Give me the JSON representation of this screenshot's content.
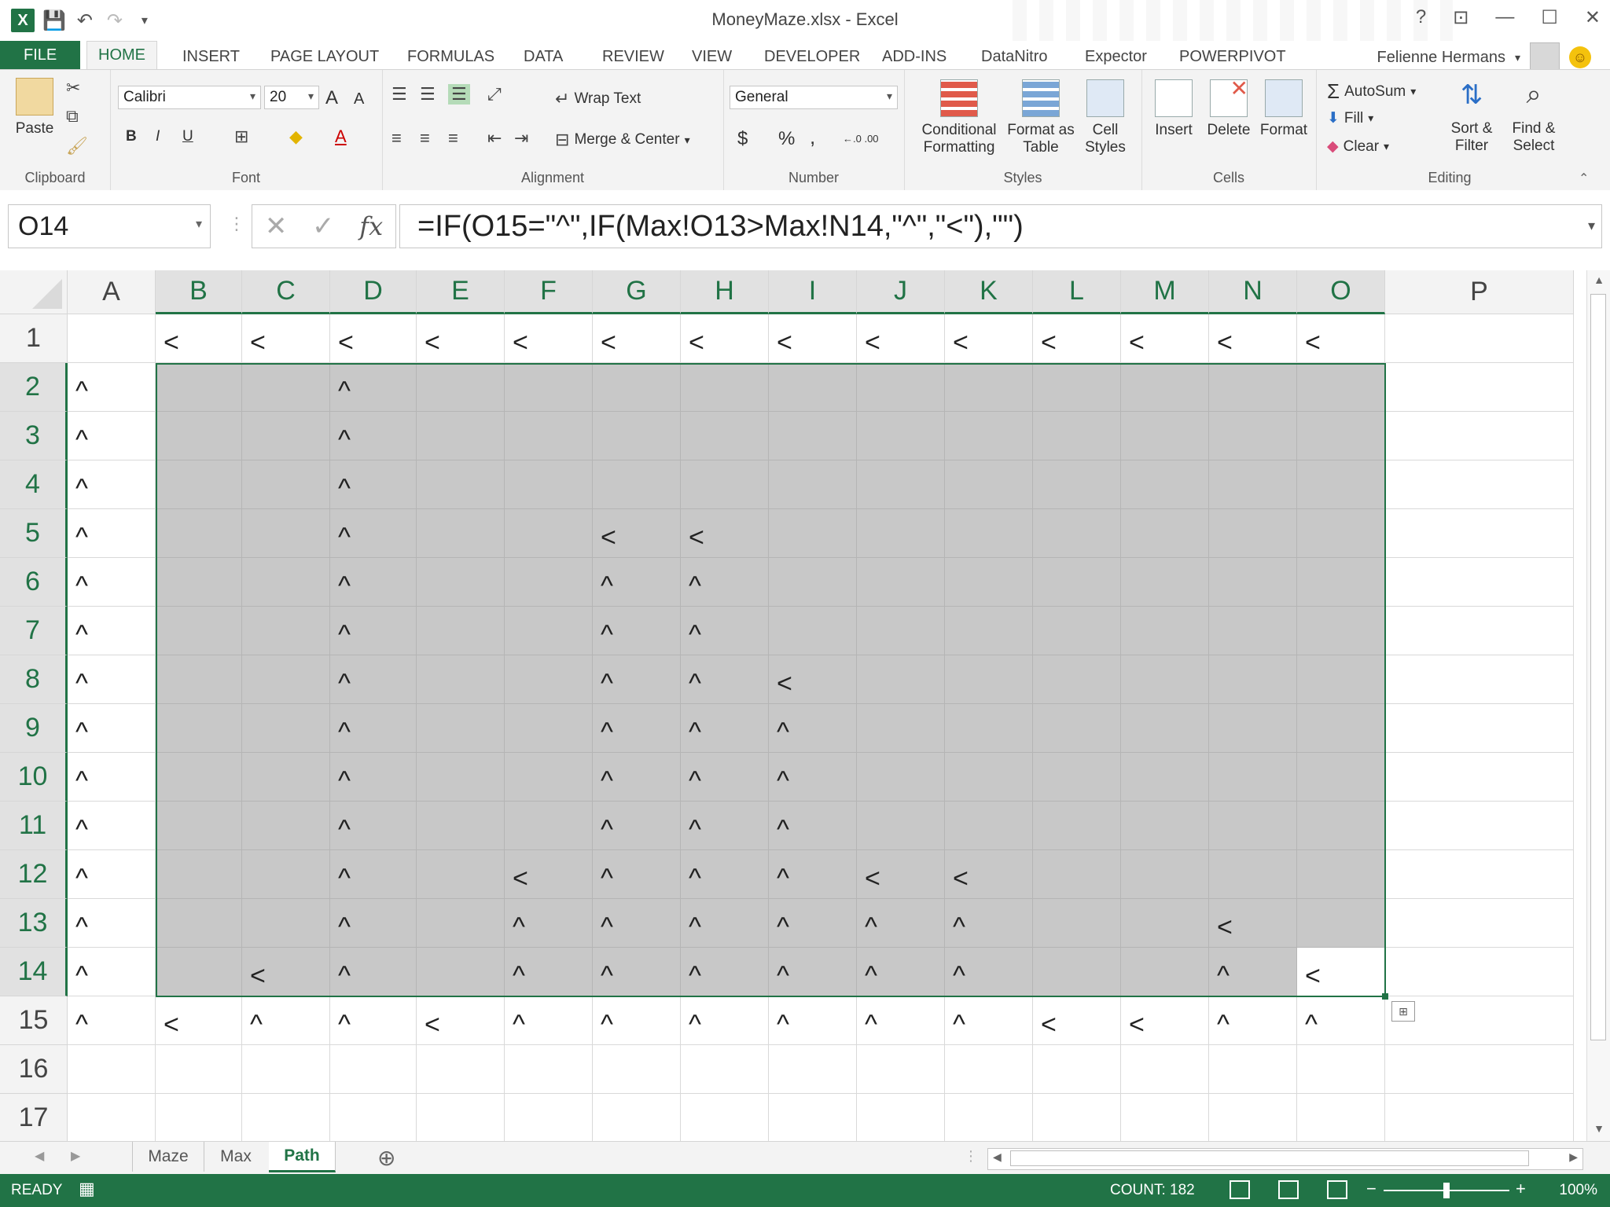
{
  "window": {
    "title": "MoneyMaze.xlsx - Excel",
    "help": "?",
    "restore_ribbon": "⊡",
    "minimize": "—",
    "maximize": "☐",
    "close": "✕"
  },
  "qat": {
    "save": "💾",
    "undo": "↶",
    "redo": "↷",
    "customize": "▾"
  },
  "tabs": [
    "FILE",
    "HOME",
    "INSERT",
    "PAGE LAYOUT",
    "FORMULAS",
    "DATA",
    "REVIEW",
    "VIEW",
    "DEVELOPER",
    "ADD-INS",
    "DataNitro",
    "Expector",
    "POWERPIVOT"
  ],
  "user": {
    "name": "Felienne Hermans"
  },
  "ribbon": {
    "clipboard": {
      "label": "Clipboard",
      "paste": "Paste"
    },
    "font": {
      "label": "Font",
      "name": "Calibri",
      "size": "20",
      "bold": "B",
      "italic": "I",
      "underline": "U",
      "grow": "A",
      "shrink": "A"
    },
    "alignment": {
      "label": "Alignment",
      "wrap": "Wrap Text",
      "merge": "Merge & Center"
    },
    "number": {
      "label": "Number",
      "format": "General",
      "currency": "$",
      "percent": "%",
      "comma": ",",
      "inc_dec": "←.0 .00",
      "dec_dec": ".00 →.0"
    },
    "styles": {
      "label": "Styles",
      "conditional1": "Conditional",
      "conditional2": "Formatting",
      "table1": "Format as",
      "table2": "Table",
      "cell1": "Cell",
      "cell2": "Styles"
    },
    "cells": {
      "label": "Cells",
      "insert": "Insert",
      "delete": "Delete",
      "format": "Format"
    },
    "editing": {
      "label": "Editing",
      "autosum": "AutoSum",
      "fill": "Fill",
      "clear": "Clear",
      "sort1": "Sort &",
      "sort2": "Filter",
      "find1": "Find &",
      "find2": "Select"
    }
  },
  "formula_bar": {
    "namebox": "O14",
    "cancel": "✕",
    "enter": "✓",
    "fx": "fx",
    "formula": "=IF(O15=\"^\",IF(Max!O13>Max!N14,\"^\",\"<\"),\"\")"
  },
  "columns": [
    "A",
    "B",
    "C",
    "D",
    "E",
    "F",
    "G",
    "H",
    "I",
    "J",
    "K",
    "L",
    "M",
    "N",
    "O",
    "P"
  ],
  "rows": [
    "1",
    "2",
    "3",
    "4",
    "5",
    "6",
    "7",
    "8",
    "9",
    "10",
    "11",
    "12",
    "13",
    "14",
    "15",
    "16",
    "17"
  ],
  "grid": [
    [
      "",
      "<",
      "<",
      "<",
      "<",
      "<",
      "<",
      "<",
      "<",
      "<",
      "<",
      "<",
      "<",
      "<",
      "<",
      ""
    ],
    [
      "^",
      "",
      "",
      "^",
      "",
      "",
      "",
      "",
      "",
      "",
      "",
      "",
      "",
      "",
      "",
      ""
    ],
    [
      "^",
      "",
      "",
      "^",
      "",
      "",
      "",
      "",
      "",
      "",
      "",
      "",
      "",
      "",
      "",
      ""
    ],
    [
      "^",
      "",
      "",
      "^",
      "",
      "",
      "",
      "",
      "",
      "",
      "",
      "",
      "",
      "",
      "",
      ""
    ],
    [
      "^",
      "",
      "",
      "^",
      "",
      "",
      "<",
      "<",
      "",
      "",
      "",
      "",
      "",
      "",
      "",
      ""
    ],
    [
      "^",
      "",
      "",
      "^",
      "",
      "",
      "^",
      "^",
      "",
      "",
      "",
      "",
      "",
      "",
      "",
      ""
    ],
    [
      "^",
      "",
      "",
      "^",
      "",
      "",
      "^",
      "^",
      "",
      "",
      "",
      "",
      "",
      "",
      "",
      ""
    ],
    [
      "^",
      "",
      "",
      "^",
      "",
      "",
      "^",
      "^",
      "<",
      "",
      "",
      "",
      "",
      "",
      "",
      ""
    ],
    [
      "^",
      "",
      "",
      "^",
      "",
      "",
      "^",
      "^",
      "^",
      "",
      "",
      "",
      "",
      "",
      "",
      ""
    ],
    [
      "^",
      "",
      "",
      "^",
      "",
      "",
      "^",
      "^",
      "^",
      "",
      "",
      "",
      "",
      "",
      "",
      ""
    ],
    [
      "^",
      "",
      "",
      "^",
      "",
      "",
      "^",
      "^",
      "^",
      "",
      "",
      "",
      "",
      "",
      "",
      ""
    ],
    [
      "^",
      "",
      "",
      "^",
      "",
      "<",
      "^",
      "^",
      "^",
      "<",
      "<",
      "",
      "",
      "",
      "",
      ""
    ],
    [
      "^",
      "",
      "",
      "^",
      "",
      "^",
      "^",
      "^",
      "^",
      "^",
      "^",
      "",
      "",
      "<",
      "",
      ""
    ],
    [
      "^",
      "",
      "<",
      "^",
      "",
      "^",
      "^",
      "^",
      "^",
      "^",
      "^",
      "",
      "",
      "^",
      "<",
      ""
    ],
    [
      "^",
      "<",
      "^",
      "^",
      "<",
      "^",
      "^",
      "^",
      "^",
      "^",
      "^",
      "<",
      "<",
      "^",
      "^",
      ""
    ],
    [
      "",
      "",
      "",
      "",
      "",
      "",
      "",
      "",
      "",
      "",
      "",
      "",
      "",
      "",
      "",
      ""
    ],
    [
      "",
      "",
      "",
      "",
      "",
      "",
      "",
      "",
      "",
      "",
      "",
      "",
      "",
      "",
      "",
      ""
    ]
  ],
  "sheets": [
    "Maze",
    "Max",
    "Path"
  ],
  "active_sheet": "Path",
  "add_sheet": "⊕",
  "status": {
    "ready": "READY",
    "count": "COUNT: 182",
    "zoom": "100%",
    "minus": "−",
    "plus": "+"
  },
  "colors": {
    "accent": "#217346",
    "selection_fill": "#c8c8c8"
  }
}
